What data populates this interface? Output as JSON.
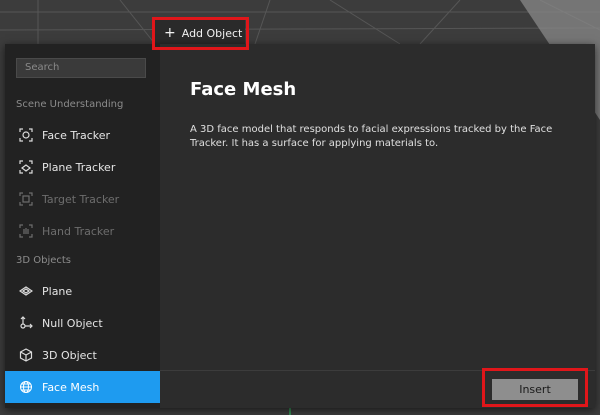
{
  "toolbar": {
    "add_object_label": "Add Object"
  },
  "dialog": {
    "search_placeholder": "Search",
    "sections": [
      {
        "header": "Scene Understanding",
        "items": [
          {
            "label": "Face Tracker",
            "icon": "face-tracker-icon",
            "disabled": false
          },
          {
            "label": "Plane Tracker",
            "icon": "plane-tracker-icon",
            "disabled": false
          },
          {
            "label": "Target Tracker",
            "icon": "target-tracker-icon",
            "disabled": true
          },
          {
            "label": "Hand Tracker",
            "icon": "hand-tracker-icon",
            "disabled": true
          }
        ]
      },
      {
        "header": "3D Objects",
        "items": [
          {
            "label": "Plane",
            "icon": "plane-icon",
            "disabled": false
          },
          {
            "label": "Null Object",
            "icon": "null-object-icon",
            "disabled": false
          },
          {
            "label": "3D Object",
            "icon": "cube-icon",
            "disabled": false
          },
          {
            "label": "Face Mesh",
            "icon": "face-mesh-icon",
            "disabled": false,
            "selected": true
          }
        ]
      }
    ],
    "detail": {
      "title": "Face Mesh",
      "description": "A 3D face model that responds to facial expressions tracked by the Face Tracker. It has a surface for applying materials to."
    },
    "insert_label": "Insert"
  },
  "colors": {
    "accent": "#1e9bf0",
    "annotation": "#e0161a"
  }
}
